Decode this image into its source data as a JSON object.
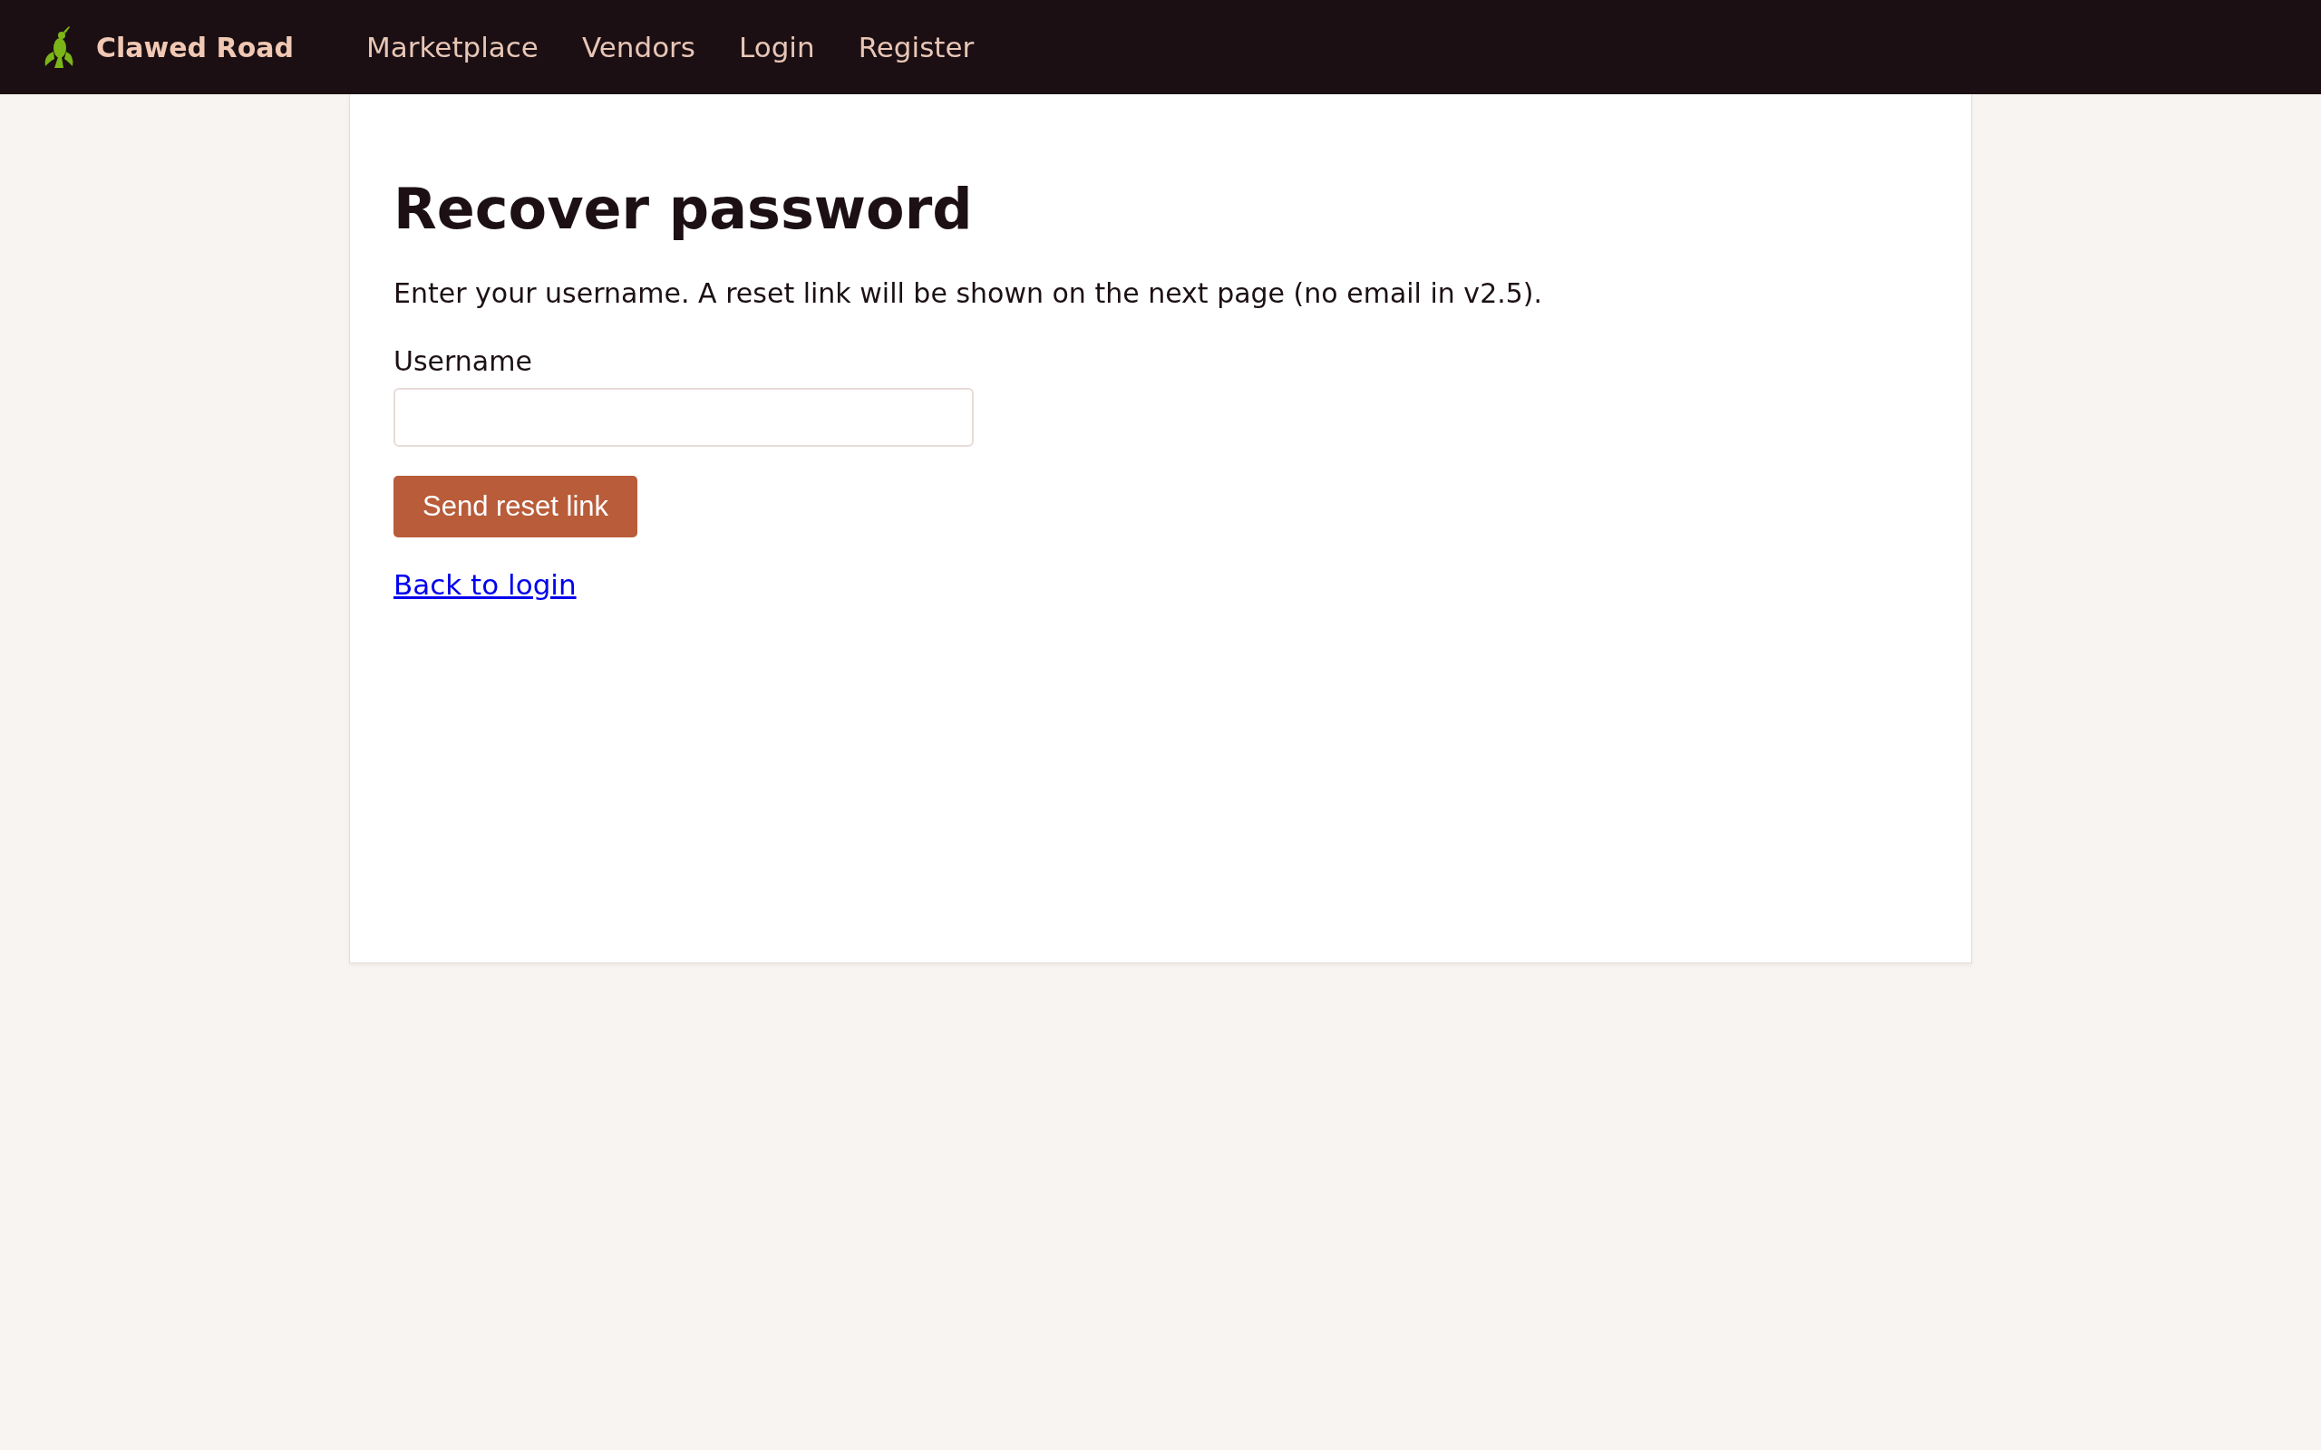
{
  "navbar": {
    "brand": "Clawed Road",
    "links": [
      "Marketplace",
      "Vendors",
      "Login",
      "Register"
    ]
  },
  "card": {
    "title": "Recover password",
    "intro": "Enter your username. A reset link will be shown on the next page (no email in v2.5).",
    "field": {
      "label": "Username"
    },
    "button": "Send reset link",
    "back_link": "Back to login"
  }
}
